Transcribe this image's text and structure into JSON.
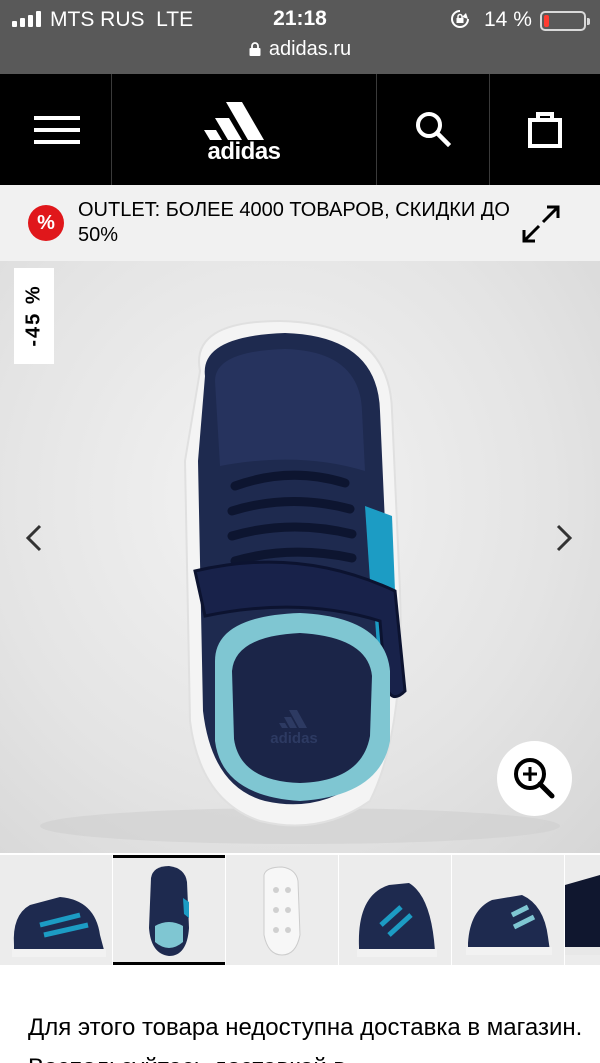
{
  "status_bar": {
    "carrier": "MTS RUS",
    "network": "LTE",
    "time": "21:18",
    "battery_percent": "14 %",
    "battery_level": 0.14,
    "url": "adidas.ru"
  },
  "header": {
    "brand": "adidas",
    "menu_icon": "hamburger-icon",
    "search_icon": "search-icon",
    "cart_icon": "shopping-bag-icon"
  },
  "banner": {
    "badge": "%",
    "text": "OUTLET: БОЛЕЕ 4000 ТОВАРОВ, СКИДКИ ДО 50%",
    "expand_icon": "expand-icon"
  },
  "product": {
    "discount": "-45 %",
    "active_thumbnail": 1
  },
  "colors": {
    "header_bg": "#000000",
    "status_bg": "#595959",
    "badge_red": "#e0171b"
  },
  "notice": "Для этого товара недоступна доставка в магазин. Воспользуйтесь доставкой в"
}
